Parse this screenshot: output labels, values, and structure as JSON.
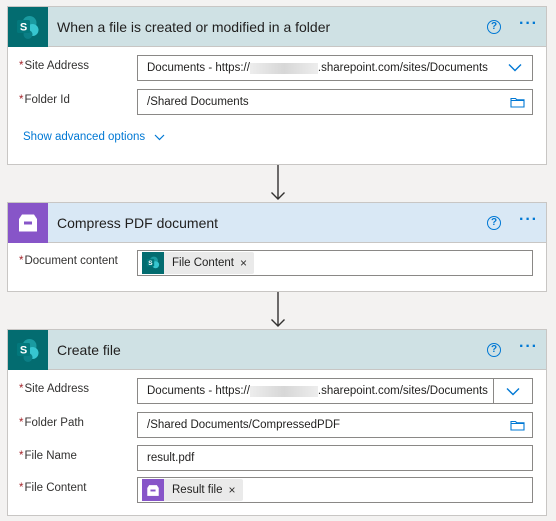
{
  "trigger": {
    "title": "When a file is created or modified in a folder",
    "site_label": "Site Address",
    "site_value_prefix": "Documents - https://",
    "site_value_suffix": ".sharepoint.com/sites/Documents",
    "folder_label": "Folder Id",
    "folder_value": "/Shared Documents",
    "advanced_link": "Show advanced options",
    "app_icon": "sharepoint-icon"
  },
  "compress": {
    "title": "Compress PDF document",
    "content_label": "Document content",
    "token_label": "File Content",
    "app_icon": "pdf-archive-icon"
  },
  "create": {
    "title": "Create file",
    "site_label": "Site Address",
    "site_value_prefix": "Documents - https://",
    "site_value_suffix": ".sharepoint.com/sites/Documents",
    "folder_label": "Folder Path",
    "folder_value": "/Shared Documents/CompressedPDF",
    "name_label": "File Name",
    "name_value": "result.pdf",
    "content_label": "File Content",
    "token_label": "Result file",
    "app_icon": "sharepoint-icon"
  },
  "required_marker": "*",
  "token_remove": "×",
  "help_glyph": "?",
  "more_glyph": "···",
  "colors": {
    "sharepoint": "#036c70",
    "pdf": "#8755c8",
    "accent": "#0078d4",
    "required": "#a4262c"
  }
}
